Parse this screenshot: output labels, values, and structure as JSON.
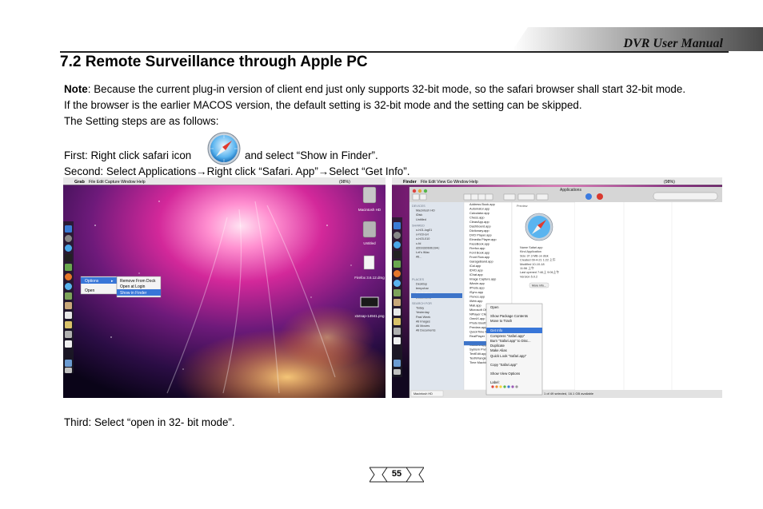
{
  "header": {
    "title": "DVR User Manual"
  },
  "section": {
    "title": "7.2 Remote Surveillance through Apple PC"
  },
  "note": {
    "label": "Note",
    "line1": ": Because the current plug-in version of client end just only supports 32-bit mode, so the safari browser shall start 32-bit mode.",
    "line2": "If the browser is the earlier MACOS version, the default setting is 32-bit mode and the setting can be skipped.",
    "line3": "The Setting steps are as follows:"
  },
  "steps": {
    "first_a": "First: Right click safari icon",
    "first_b": "and select “Show in Finder”.",
    "second_a": "Second: Select Applications",
    "second_b": "Right click “Safari. App”",
    "second_c": "Select “Get Info”.",
    "arrow": "→",
    "third": "Third: Select “open in 32- bit mode”."
  },
  "screenshot_left": {
    "menubar": {
      "app": "Grab",
      "items": [
        "File",
        "Edit",
        "Capture",
        "Window",
        "Help"
      ],
      "status": "(98%)"
    },
    "desktop_items": [
      "Macintosh HD",
      "Untitled",
      "Firefox 3.6.12.dmg",
      "xtxtsap-14941.png"
    ],
    "context_menu": {
      "items": [
        "Options",
        "Open"
      ],
      "submenu": [
        "Remove From Dock",
        "Open at Login",
        "Show in Finder"
      ]
    }
  },
  "screenshot_right": {
    "menubar": {
      "app": "Finder",
      "items": [
        "File",
        "Edit",
        "View",
        "Go",
        "Window",
        "Help"
      ],
      "status": "(98%)"
    },
    "window_title": "Applications",
    "sidebar": {
      "devices_label": "DEVICES",
      "devices": [
        "Macintosh HD",
        "iDisk",
        "Untitled"
      ],
      "shared_label": "SHARED",
      "shared": [
        "o-h01-log01",
        "o-h03-svr",
        "o-h03-010",
        "c-fd",
        "d2b9330b9b194c",
        "t-el's iMac",
        "All..."
      ],
      "places_label": "PLACES",
      "places": [
        "Desktop",
        "tempchar",
        "Applications",
        "Documents"
      ],
      "search_label": "SEARCH FOR",
      "search": [
        "Today",
        "Yesterday",
        "Past Week",
        "All Images",
        "All Movies",
        "All Documents"
      ]
    },
    "apps": [
      "Address Book.app",
      "Automator.app",
      "Calculator.app",
      "Chess.app",
      "CleanApp.app",
      "Dashboard.app",
      "Dictionary.app",
      "DVD Player.app",
      "Elmedia Player.app",
      "FaceBook.app",
      "Firefox.app",
      "Font Book.app",
      "Front Row.app",
      "GarageBand.app",
      "iCal.app",
      "iDVD.app",
      "iChat.app",
      "Image Capture.app",
      "iMovie.app",
      "iPhoto.app",
      "iSync.app",
      "iTunes.app",
      "iWeb.app",
      "Mail.app",
      "Microsoft Office",
      "NPlayer Client",
      "OmniX.app",
      "Photo Booth",
      "Preview.app",
      "QuickTime Player",
      "RealPlayer",
      "Safari.app",
      "Stickies.app",
      "System Pref",
      "TextEdit.app",
      "TextWrangler",
      "Time Machine"
    ],
    "preview": {
      "label": "Preview",
      "info": [
        "Name Safari.app",
        "Kind Application",
        "Size 37.3 MB on disk",
        "Created 09-4-21 1:22 上午",
        "Modified 10-10-18",
        "11:56 上午",
        "Last opened 7:46上 9:06上午",
        "Version 5.0.2"
      ],
      "more": "More info..."
    },
    "context_menu": [
      "Open",
      "Show Package Contents",
      "Move to Trash",
      "Get Info",
      "Compress “Safari.app”",
      "Burn “Safari.app” to Disc...",
      "Duplicate",
      "Make Alias",
      "Quick Look “Safari.app”",
      "Copy “Safari.app”",
      "Show View Options",
      "Label:"
    ],
    "status": "1 of 49 selected, 16.1 GB available",
    "path": "Macintosh HD"
  },
  "page_number": "55",
  "colors": {
    "header_band": "#5a5a5a",
    "menu_highlight": "#3876d8",
    "finder_selection": "#3d74c9",
    "desktop_magenta": "#c0208a",
    "desktop_orange": "#ff9a3a"
  }
}
